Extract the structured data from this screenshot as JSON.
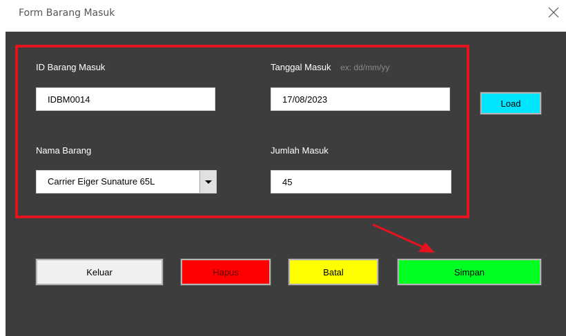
{
  "window": {
    "title": "Form Barang Masuk",
    "close_icon": "close-icon"
  },
  "form": {
    "id_label": "ID Barang Masuk",
    "id_value": "IDBM0014",
    "tanggal_label": "Tanggal Masuk",
    "tanggal_hint": "ex: dd/mm/yy",
    "tanggal_value": "17/08/2023",
    "nama_label": "Nama Barang",
    "nama_value": "Carrier Eiger Sunature 65L",
    "jumlah_label": "Jumlah Masuk",
    "jumlah_value": "45"
  },
  "buttons": {
    "load": "Load",
    "keluar": "Keluar",
    "hapus": "Hapus",
    "batal": "Batal",
    "simpan": "Simpan"
  },
  "colors": {
    "background": "#3d3d3d",
    "highlight": "#e5131d",
    "load": "#00e5ff",
    "keluar": "#f0f0f0",
    "hapus": "#ff0000",
    "batal": "#ffff00",
    "simpan": "#00ff22"
  }
}
